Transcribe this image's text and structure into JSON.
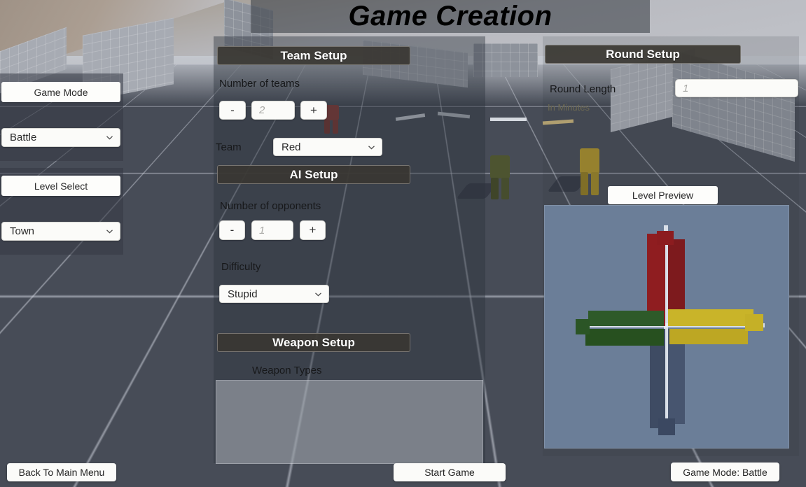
{
  "header": {
    "title": "Game Creation"
  },
  "sidebar": {
    "group1": {
      "label": "Game Mode",
      "dropdown": {
        "value": "Battle",
        "icon": "chevron-down-icon"
      }
    },
    "group2": {
      "label": "Level Select",
      "dropdown": {
        "value": "Town",
        "icon": "chevron-down-icon"
      }
    }
  },
  "team_setup": {
    "title": "Team Setup",
    "number_of_teams": {
      "label": "Number of teams",
      "decrement": "-",
      "increment": "+",
      "value": "2"
    },
    "team": {
      "label": "Team",
      "dropdown": {
        "value": "Red",
        "icon": "chevron-down-icon"
      }
    }
  },
  "ai_setup": {
    "title": "AI Setup",
    "number_of_opponents": {
      "label": "Number of opponents",
      "decrement": "-",
      "increment": "+",
      "value": "1"
    },
    "difficulty": {
      "label": "Difficulty",
      "dropdown": {
        "value": "Stupid",
        "icon": "chevron-down-icon"
      }
    }
  },
  "weapon_setup": {
    "title": "Weapon Setup",
    "weapon_types_label": "Weapon Types",
    "weapon_types_items": []
  },
  "round_setup": {
    "title": "Round Setup",
    "round_length": {
      "label": "Round Length",
      "sub_label": "In Minutes",
      "value": "1"
    }
  },
  "level_preview": {
    "label": "Level Preview",
    "background_color": "#6b7e98",
    "blocks": [
      {
        "name": "north-building-red",
        "color": "#8f1d20"
      },
      {
        "name": "east-building-yellow",
        "color": "#c9b429"
      },
      {
        "name": "south-building-blue",
        "color": "#414f68"
      },
      {
        "name": "west-building-green",
        "color": "#2e5a29"
      }
    ]
  },
  "footer": {
    "back_button": "Back To Main Menu",
    "start_button": "Start Game",
    "mode_badge": "Game Mode: Battle"
  }
}
